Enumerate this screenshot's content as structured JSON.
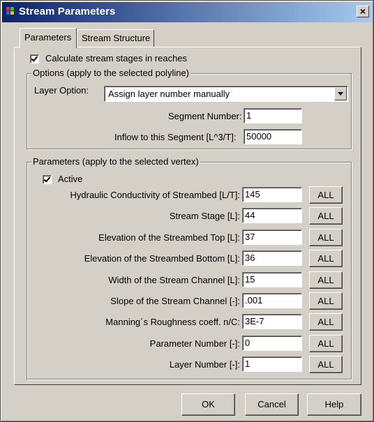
{
  "window": {
    "title": "Stream Parameters",
    "close_label": "×"
  },
  "tabs": [
    {
      "label": "Parameters"
    },
    {
      "label": "Stream Structure"
    }
  ],
  "calc_stages": {
    "label": "Calculate stream stages in reaches",
    "checked": true
  },
  "options_group": {
    "title": "Options (apply to the selected polyline)",
    "layer_option_label": "Layer Option:",
    "layer_option_value": "Assign layer number manually",
    "segment_number_label": "Segment Number:",
    "segment_number_value": "1",
    "inflow_label": "Inflow to this Segment [L^3/T]:",
    "inflow_value": "50000"
  },
  "params_group": {
    "title": "Parameters (apply to the selected vertex)",
    "active_label": "Active",
    "active_checked": true,
    "all_label": "ALL",
    "rows": [
      {
        "label": "Hydraulic Conductivity of Streambed [L/T]:",
        "value": "145"
      },
      {
        "label": "Stream Stage [L]:",
        "value": "44"
      },
      {
        "label": "Elevation of the Streambed Top [L]:",
        "value": "37"
      },
      {
        "label": "Elevation of the Streambed Bottom [L]:",
        "value": "36"
      },
      {
        "label": "Width of the Stream Channel [L]:",
        "value": "15"
      },
      {
        "label": "Slope of the Stream Channel [-]:",
        "value": ".001"
      },
      {
        "label": "Manning´s Roughness coeff. n/C:",
        "value": "3E-7"
      },
      {
        "label": "Parameter Number [-]:",
        "value": "0"
      },
      {
        "label": "Layer Number [-]:",
        "value": "1"
      }
    ]
  },
  "buttons": {
    "ok": "OK",
    "cancel": "Cancel",
    "help": "Help"
  },
  "colors": {
    "titlebar_start": "#0a246a",
    "titlebar_end": "#a6caf0",
    "face": "#d4d0c8"
  }
}
